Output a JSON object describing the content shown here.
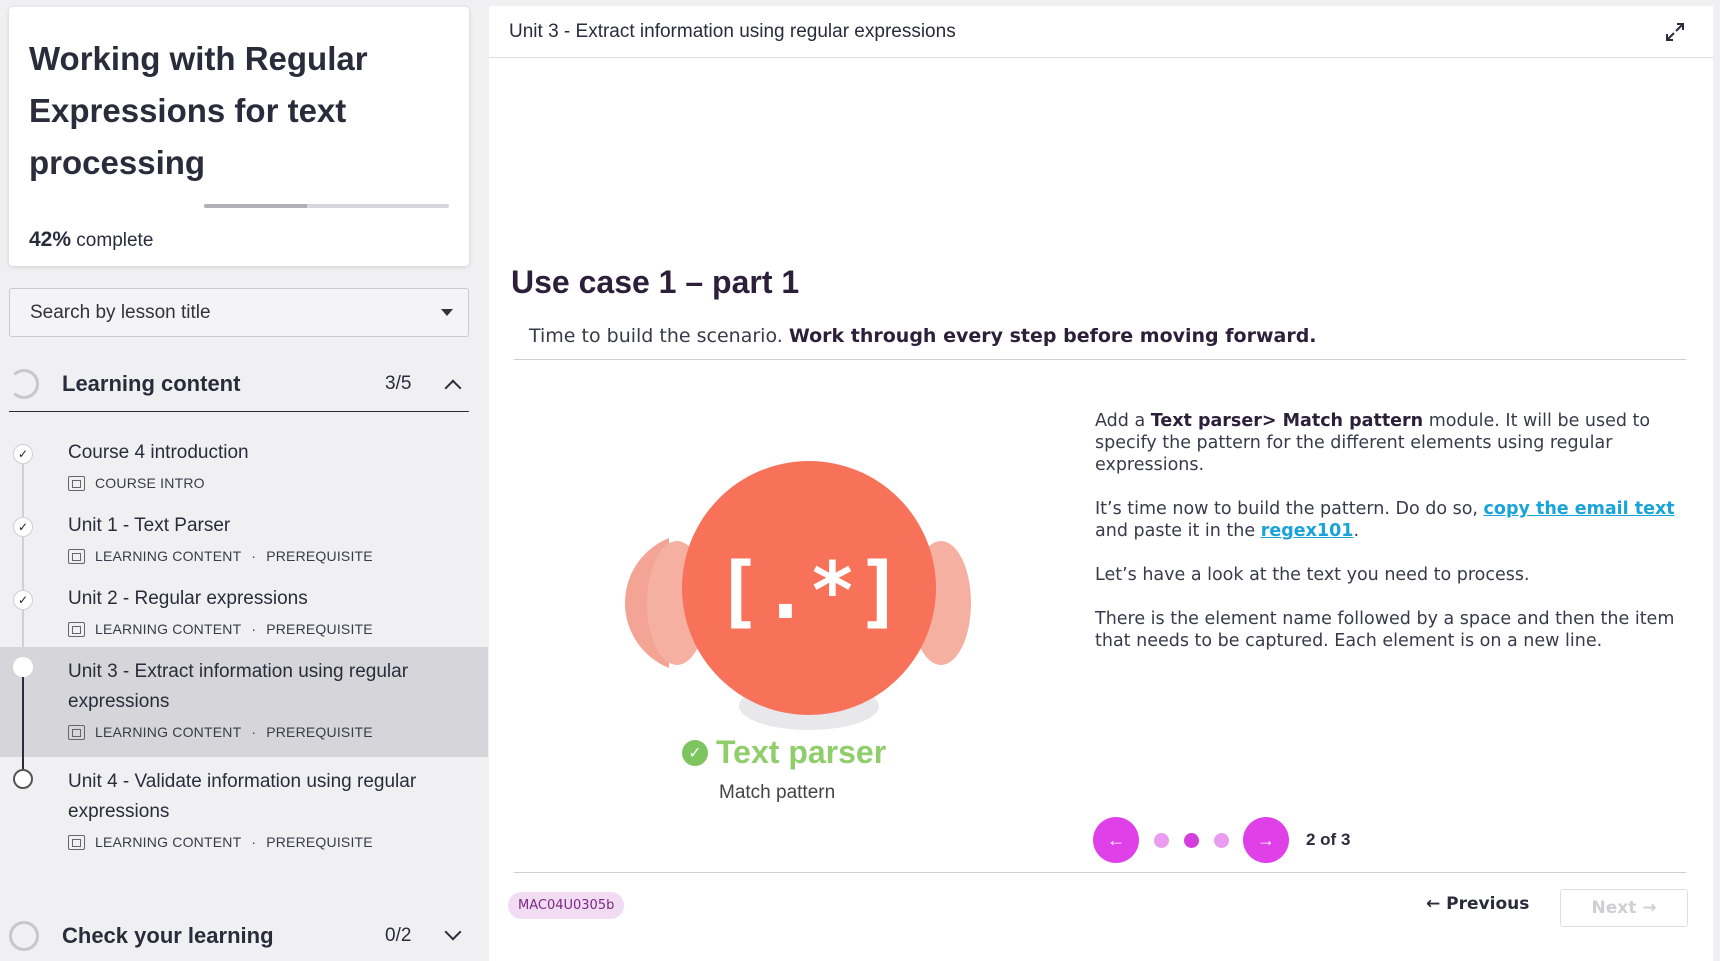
{
  "course": {
    "title": "Working with Regular Expressions for text processing",
    "progress_percent": 42,
    "progress_value": "42%",
    "progress_suffix": " complete"
  },
  "search": {
    "placeholder": "Search by lesson title"
  },
  "sections": [
    {
      "label": "Learning content",
      "count": "3/5",
      "expanded": true
    },
    {
      "label": "Check your learning",
      "count": "0/2",
      "expanded": false
    }
  ],
  "lessons": [
    {
      "title": "Course 4 introduction",
      "type": "COURSE INTRO",
      "prereq": "",
      "status": "done"
    },
    {
      "title": "Unit 1 - Text Parser",
      "type": "LEARNING CONTENT",
      "prereq": "PREREQUISITE",
      "status": "done"
    },
    {
      "title": "Unit 2 - Regular expressions",
      "type": "LEARNING CONTENT",
      "prereq": "PREREQUISITE",
      "status": "done"
    },
    {
      "title": "Unit 3 - Extract information using regular expressions",
      "type": "LEARNING CONTENT",
      "prereq": "PREREQUISITE",
      "status": "current"
    },
    {
      "title": "Unit 4 - Validate information using regular expressions",
      "type": "LEARNING CONTENT",
      "prereq": "PREREQUISITE",
      "status": "open"
    }
  ],
  "meta_separator": "·",
  "main": {
    "unit_title": "Unit 3 - Extract information using regular expressions",
    "heading": "Use case 1 – part 1",
    "intro_plain": "Time to build the scenario. ",
    "intro_bold": "Work through every step before moving forward.",
    "illustration": {
      "glyph": "[.*]",
      "name": "Text parser",
      "subtitle": "Match pattern"
    },
    "para1_a": "Add a ",
    "para1_b": "Text parser> Match pattern",
    "para1_c": " module. It will be used to specify the pattern for the different elements using regular expressions.",
    "para2_a": "It’s time now to build the pattern. Do do so, ",
    "para2_link1": "copy the email text",
    "para2_b": " and paste it in the ",
    "para2_link2": "regex101",
    "para2_c": ".",
    "para3": "Let’s have a look at the text you need to process.",
    "para4": "There is the element name followed by a space and then the item that needs to be captured. Each element is on a new line.",
    "pager": {
      "current": 2,
      "total": 3,
      "label": "2 of 3"
    },
    "code": "MAC04U0305b",
    "prev_label": "Previous",
    "next_label": "Next"
  },
  "colors": {
    "accent": "#e040e8",
    "illustration_orange": "#f8725a",
    "text_parser_green": "#8fce6a",
    "link": "#1aa3d9"
  }
}
